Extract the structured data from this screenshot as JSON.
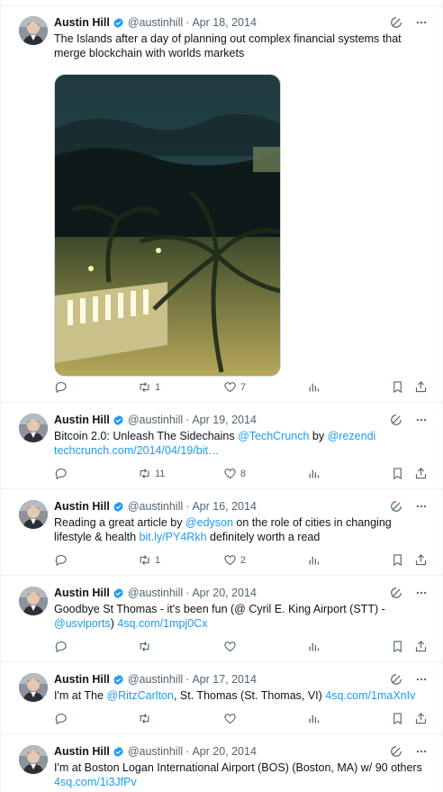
{
  "author": {
    "name": "Austin Hill",
    "handle": "@austinhill"
  },
  "colors": {
    "accent": "#1d9bf0",
    "text": "#0f1419",
    "muted": "#536471",
    "border": "#eff3f4"
  },
  "icons": {
    "verified": "verified-badge-icon",
    "grok": "grok-icon",
    "more": "more-icon",
    "reply": "reply-icon",
    "retweet": "retweet-icon",
    "like": "like-icon",
    "views": "views-icon",
    "bookmark": "bookmark-icon",
    "share": "share-icon"
  },
  "tweets": [
    {
      "date": "Apr 18, 2014",
      "text": "The Islands after a day of planning out complex financial systems that merge blockchain with worlds markets",
      "has_photo": true,
      "retweets": "1",
      "likes": "7"
    },
    {
      "date": "Apr 19, 2014",
      "text_before": "Bitcoin 2.0: Unleash The Sidechains ",
      "mention1": "@TechCrunch",
      "text_middle": " by ",
      "mention2": "@rezendi",
      "link": "techcrunch.com/2014/04/19/bit…",
      "retweets": "11",
      "likes": "8"
    },
    {
      "date": "Apr 16, 2014",
      "text_before": "Reading a great article by ",
      "mention1": "@edyson",
      "text_middle": " on the role of cities in changing lifestyle & health ",
      "link": "bit.ly/PY4Rkh",
      "text_after": " definitely worth a read",
      "retweets": "1",
      "likes": "2"
    },
    {
      "date": "Apr 20, 2014",
      "text_before": "Goodbye St Thomas - it's been fun (@ Cyril E. King Airport (STT) - ",
      "mention1": "@usviports",
      "text_middle": ") ",
      "link": "4sq.com/1mpj0Cx",
      "retweets": "",
      "likes": ""
    },
    {
      "date": "Apr 17, 2014",
      "text_before": "I'm at The ",
      "mention1": "@RitzCarlton",
      "text_middle": ", St. Thomas (St. Thomas, VI) ",
      "link": "4sq.com/1maXnIv",
      "retweets": "",
      "likes": ""
    },
    {
      "date": "Apr 20, 2014",
      "text_before": "I'm at Boston Logan International Airport (BOS) (Boston, MA) w/ 90 others ",
      "link": "4sq.com/1i3JfPv"
    }
  ]
}
